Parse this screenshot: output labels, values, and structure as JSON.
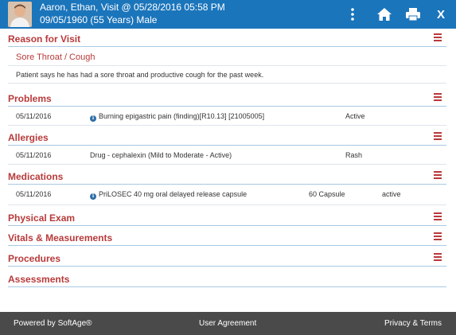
{
  "header": {
    "line1": "Aaron, Ethan, Visit @ 05/28/2016 05:58 PM",
    "line2": "09/05/1960 (55 Years) Male",
    "close_label": "X",
    "background": "#1b75bb"
  },
  "reason": {
    "title": "Reason for Visit",
    "complaint": "Sore Throat / Cough",
    "note": "Patient says he has had a sore throat and productive cough for the past week."
  },
  "problems": {
    "title": "Problems",
    "rows": [
      {
        "date": "05/11/2016",
        "description": "Burning epigastric pain (finding)[R10.13] [21005005]",
        "status": "Active"
      }
    ]
  },
  "allergies": {
    "title": "Allergies",
    "rows": [
      {
        "date": "05/11/2016",
        "description": "Drug - cephalexin (Mild to Moderate - Active)",
        "reaction": "Rash"
      }
    ]
  },
  "medications": {
    "title": "Medications",
    "rows": [
      {
        "date": "05/11/2016",
        "description": "PriLOSEC 40 mg oral delayed release capsule",
        "quantity": "60 Capsule",
        "status": "active"
      }
    ]
  },
  "physical_exam": {
    "title": "Physical Exam"
  },
  "vitals": {
    "title": "Vitals & Measurements"
  },
  "procedures": {
    "title": "Procedures"
  },
  "assessments": {
    "title": "Assessments"
  },
  "footer": {
    "powered_by": "Powered by SoftAge®",
    "user_agreement": "User Agreement",
    "privacy": "Privacy & Terms"
  },
  "colors": {
    "accent": "#1b75bb",
    "section_title": "#b83a3a",
    "footer_bg": "#4a4a4a"
  }
}
